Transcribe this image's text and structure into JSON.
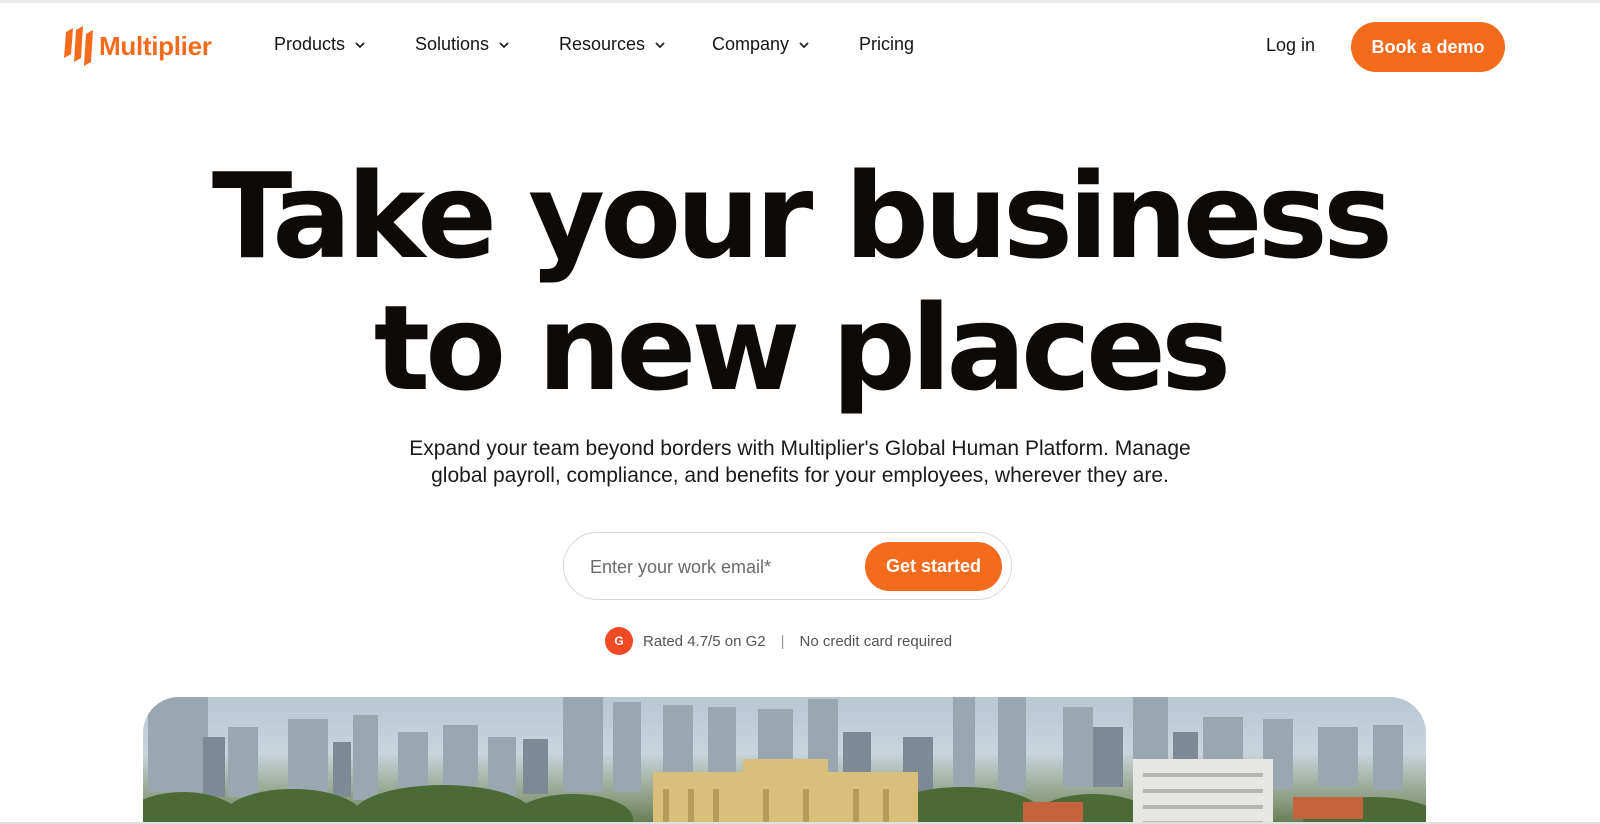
{
  "brand": {
    "name": "Multiplier",
    "accent_color": "#f46b1e"
  },
  "nav": {
    "items": [
      {
        "label": "Products",
        "has_dropdown": true
      },
      {
        "label": "Solutions",
        "has_dropdown": true
      },
      {
        "label": "Resources",
        "has_dropdown": true
      },
      {
        "label": "Company",
        "has_dropdown": true
      },
      {
        "label": "Pricing",
        "has_dropdown": false
      }
    ],
    "login_label": "Log in",
    "demo_label": "Book a demo"
  },
  "hero": {
    "headline_line1": "Take your business",
    "headline_line2": "to new places",
    "subtitle_line1": "Expand your team beyond borders with Multiplier's Global Human Platform. Manage",
    "subtitle_line2": "global payroll, compliance, and benefits for your employees, wherever they are.",
    "email_placeholder": "Enter your work email*",
    "cta_label": "Get started",
    "g2_icon": "g2-logo-icon",
    "g2_badge": "G",
    "rating_text": "Rated 4.7/5 on G2",
    "separator": "|",
    "no_card_text": "No credit card required"
  },
  "banner": {
    "icon": "city-skyline-photo"
  }
}
